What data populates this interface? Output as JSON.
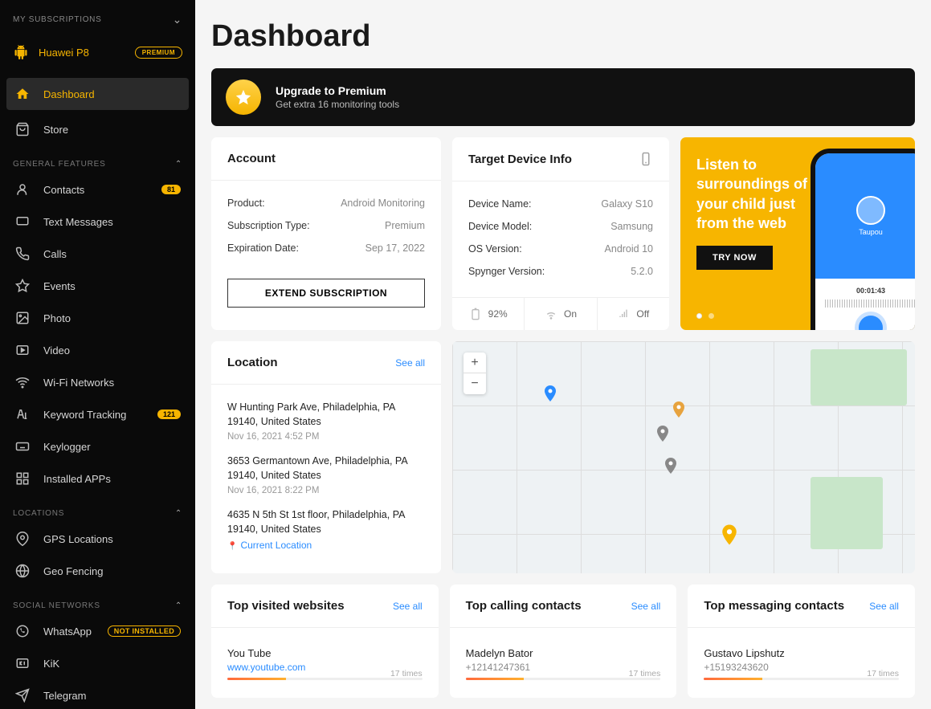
{
  "sidebar": {
    "subscriptions_label": "MY SUBSCRIPTIONS",
    "device_name": "Huawei P8",
    "device_badge": "PREMIUM",
    "nav_dashboard": "Dashboard",
    "nav_store": "Store",
    "section_general": "GENERAL FEATURES",
    "nav_contacts": "Contacts",
    "badge_contacts": "81",
    "nav_text_messages": "Text Messages",
    "nav_calls": "Calls",
    "nav_events": "Events",
    "nav_photo": "Photo",
    "nav_video": "Video",
    "nav_wifi": "Wi-Fi Networks",
    "nav_keyword": "Keyword Tracking",
    "badge_keyword": "121",
    "nav_keylogger": "Keylogger",
    "nav_installed": "Installed APPs",
    "section_locations": "LOCATIONS",
    "nav_gps": "GPS Locations",
    "nav_geo": "Geo Fencing",
    "section_social": "SOCIAL NETWORKS",
    "nav_whatsapp": "WhatsApp",
    "badge_whatsapp": "NOT INSTALLED",
    "nav_kik": "KiK",
    "nav_telegram": "Telegram"
  },
  "page_title": "Dashboard",
  "upgrade": {
    "title": "Upgrade to Premium",
    "subtitle": "Get extra 16 monitoring tools"
  },
  "account": {
    "header": "Account",
    "product_k": "Product:",
    "product_v": "Android Monitoring",
    "sub_k": "Subscription Type:",
    "sub_v": "Premium",
    "exp_k": "Expiration Date:",
    "exp_v": "Sep 17, 2022",
    "extend_btn": "EXTEND SUBSCRIPTION"
  },
  "target": {
    "header": "Target Device Info",
    "name_k": "Device Name:",
    "name_v": "Galaxy S10",
    "model_k": "Device Model:",
    "model_v": "Samsung",
    "os_k": "OS Version:",
    "os_v": "Android 10",
    "spy_k": "Spynger Version:",
    "spy_v": "5.2.0",
    "battery": "92%",
    "wifi": "On",
    "signal": "Off"
  },
  "promo": {
    "text": "Listen to surroundings of your child just from the web",
    "btn": "TRY NOW",
    "audio_time": "00:01:43"
  },
  "location": {
    "header": "Location",
    "see_all": "See all",
    "items": [
      {
        "addr": "W Hunting Park Ave, Philadelphia, PA 19140, United States",
        "dt": "Nov 16, 2021 4:52 PM",
        "current": false
      },
      {
        "addr": "3653 Germantown Ave, Philadelphia, PA 19140, United States",
        "dt": "Nov 16, 2021 8:22 PM",
        "current": false
      },
      {
        "addr": "4635 N 5th St 1st floor, Philadelphia, PA 19140, United States",
        "dt": "",
        "current": true,
        "current_label": "Current Location"
      }
    ]
  },
  "top_sites": {
    "header": "Top visited websites",
    "see_all": "See all",
    "items": [
      {
        "name": "You Tube",
        "url": "www.youtube.com",
        "count": "17 times",
        "pct": 30
      }
    ]
  },
  "top_calls": {
    "header": "Top calling contacts",
    "see_all": "See all",
    "items": [
      {
        "name": "Madelyn Bator",
        "sub": "+12141247361",
        "count": "17 times",
        "pct": 30
      }
    ]
  },
  "top_msgs": {
    "header": "Top messaging contacts",
    "see_all": "See all",
    "items": [
      {
        "name": "Gustavo Lipshutz",
        "sub": "+15193243620",
        "count": "17 times",
        "pct": 30
      }
    ]
  }
}
